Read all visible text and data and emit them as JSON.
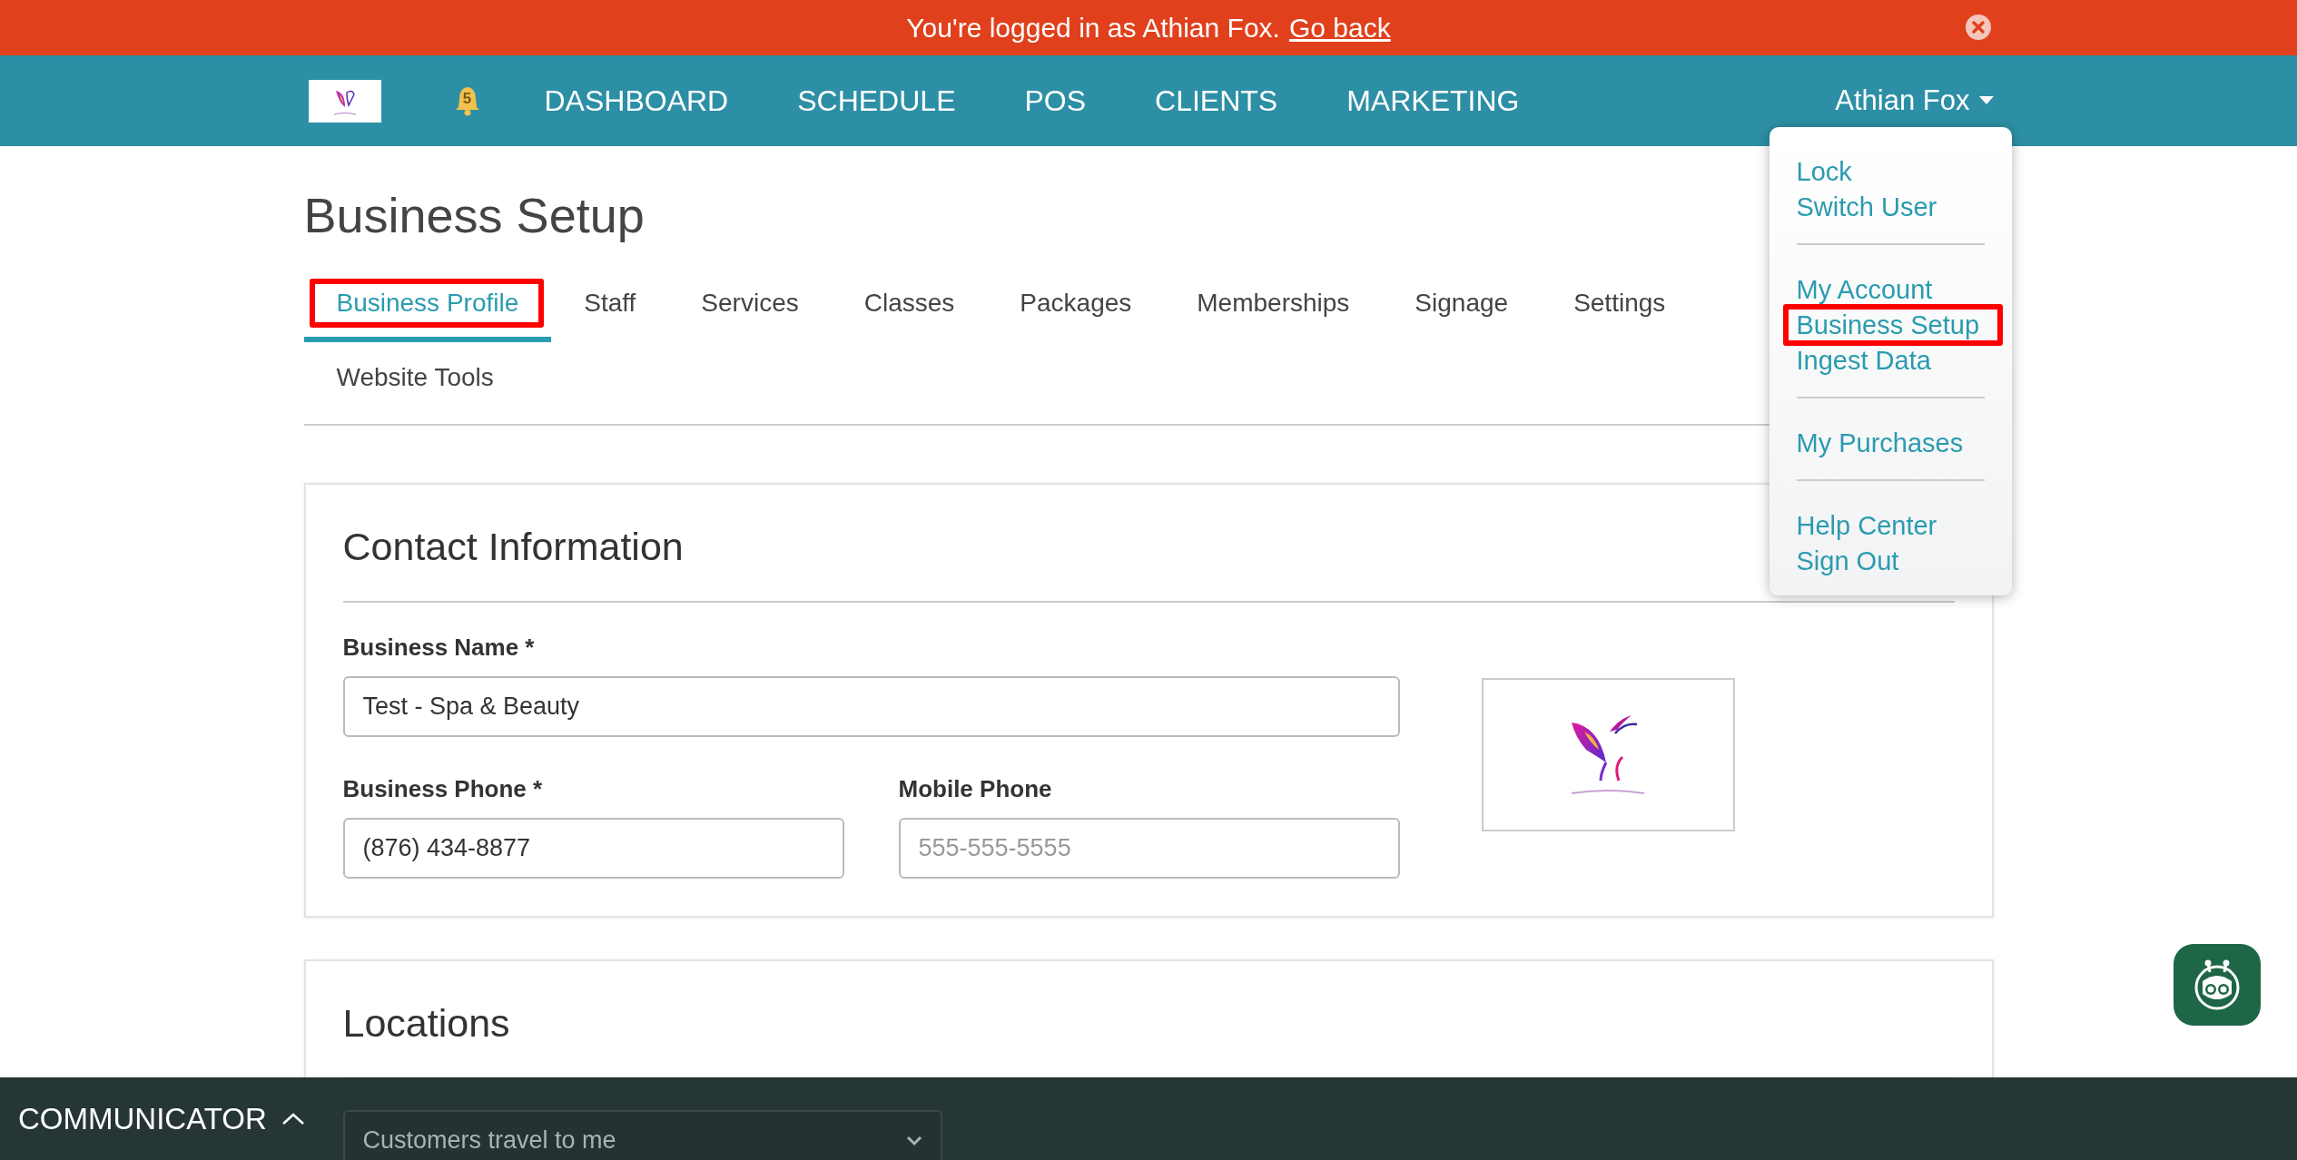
{
  "banner": {
    "message": "You're logged in as Athian Fox.",
    "link": "Go back"
  },
  "nav": {
    "notification_count": "5",
    "items": [
      "DASHBOARD",
      "SCHEDULE",
      "POS",
      "CLIENTS",
      "MARKETING"
    ],
    "user": "Athian Fox"
  },
  "user_menu": {
    "groups": [
      {
        "items": [
          {
            "label": "Lock",
            "highlighted": false
          },
          {
            "label": "Switch User",
            "highlighted": false
          }
        ]
      },
      {
        "items": [
          {
            "label": "My Account",
            "highlighted": false
          },
          {
            "label": "Business Setup",
            "highlighted": true
          },
          {
            "label": "Ingest Data",
            "highlighted": false
          }
        ]
      },
      {
        "items": [
          {
            "label": "My Purchases",
            "highlighted": false
          }
        ]
      },
      {
        "items": [
          {
            "label": "Help Center",
            "highlighted": false
          },
          {
            "label": "Sign Out",
            "highlighted": false
          }
        ]
      }
    ]
  },
  "page_title": "Business Setup",
  "tabs": [
    {
      "label": "Business Profile",
      "selected": true,
      "highlighted": true
    },
    {
      "label": "Staff",
      "selected": false,
      "highlighted": false
    },
    {
      "label": "Services",
      "selected": false,
      "highlighted": false
    },
    {
      "label": "Classes",
      "selected": false,
      "highlighted": false
    },
    {
      "label": "Packages",
      "selected": false,
      "highlighted": false
    },
    {
      "label": "Memberships",
      "selected": false,
      "highlighted": false
    },
    {
      "label": "Signage",
      "selected": false,
      "highlighted": false
    },
    {
      "label": "Settings",
      "selected": false,
      "highlighted": false
    },
    {
      "label": "Website Tools",
      "selected": false,
      "highlighted": false
    }
  ],
  "contact_card": {
    "title": "Contact Information",
    "fields": [
      {
        "kind": "wide",
        "label": "Business Name *",
        "value": "Test - Spa & Beauty"
      },
      {
        "kind": "half",
        "label": "Business Phone *",
        "value": "(876) 434-8877"
      },
      {
        "kind": "half",
        "label": "Mobile Phone",
        "placeholder": "555-555-5555"
      }
    ]
  },
  "locations_card": {
    "title": "Locations",
    "select": {
      "value": "Customers travel to me"
    }
  },
  "communicator": {
    "label": "COMMUNICATOR",
    "expanded": false
  }
}
